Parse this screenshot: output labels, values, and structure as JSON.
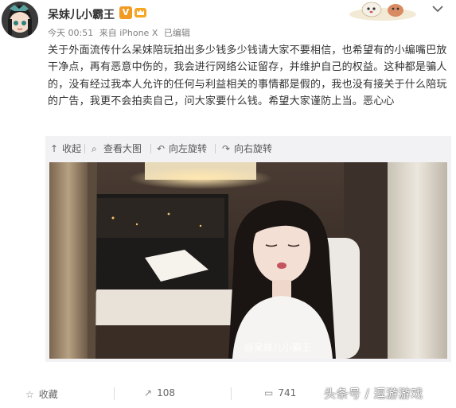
{
  "account": {
    "name": "呆妹儿小霸王",
    "verified_label": "V",
    "time": "今天 00:51",
    "source": "来自 iPhone X",
    "edited": "已编辑"
  },
  "post": {
    "text": "关于外面流传什么呆妹陪玩拍出多少钱多少钱请大家不要相信，也希望有的小编嘴巴放干净点，再有恶意中伤的，我会进行网络公证留存，并维护自己的权益。这种都是骗人的，没有经过我本人允许的任何与利益相关的事情都是假的，我也没有接关于什么陪玩的广告，我更不会拍卖自己，问大家要什么钱。希望大家谨防上当。恶心心"
  },
  "media_toolbar": {
    "collapse": "收起",
    "view_large": "查看大图",
    "rotate_left": "向左旋转",
    "rotate_right": "向右旋转"
  },
  "photo": {
    "watermark": "@呆妹儿小霸王"
  },
  "footer": {
    "favorite": "收藏",
    "repost_count": "108",
    "comment_count": "741"
  },
  "brand": "头条号 / 逗游游戏",
  "icons": {
    "collapse": "collapse-arrow-icon",
    "view_large": "magnifier-icon",
    "rotate_left": "rotate-left-icon",
    "rotate_right": "rotate-right-icon",
    "favorite": "star-icon",
    "repost": "repost-icon",
    "comment": "comment-icon",
    "more": "chevron-down-icon"
  },
  "colors": {
    "accent": "#f19b25",
    "text": "#333333",
    "meta": "#808080"
  }
}
